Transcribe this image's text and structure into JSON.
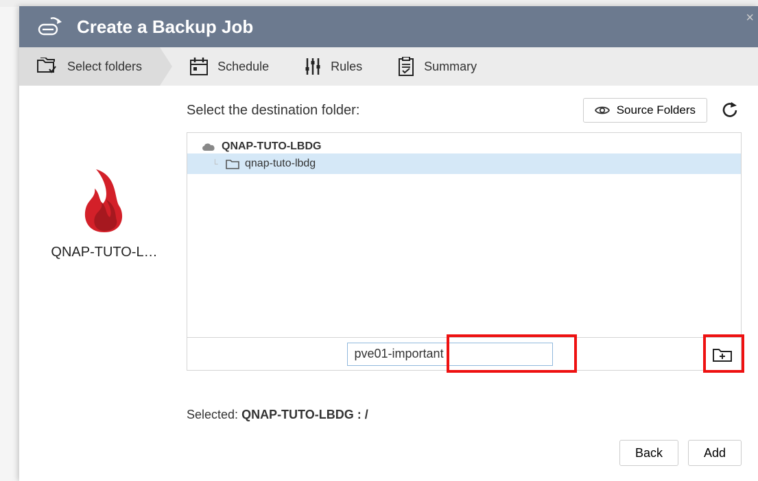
{
  "dialog": {
    "title": "Create a Backup Job"
  },
  "steps": {
    "select_folders": "Select folders",
    "schedule": "Schedule",
    "rules": "Rules",
    "summary": "Summary"
  },
  "side": {
    "provider_label": "QNAP-TUTO-L…"
  },
  "main": {
    "destination_label": "Select the destination folder:",
    "source_folders_btn": "Source Folders",
    "tree": {
      "root": "QNAP-TUTO-LBDG",
      "child": "qnap-tuto-lbdg"
    },
    "new_folder_value": "pve01-important",
    "selected_label": "Selected: ",
    "selected_value": "QNAP-TUTO-LBDG : /"
  },
  "footer": {
    "back": "Back",
    "add": "Add"
  },
  "colors": {
    "header_bg": "#6c7a8f",
    "accent_red": "#d32029",
    "highlight_red": "#e11",
    "row_selected": "#d5e8f7"
  }
}
